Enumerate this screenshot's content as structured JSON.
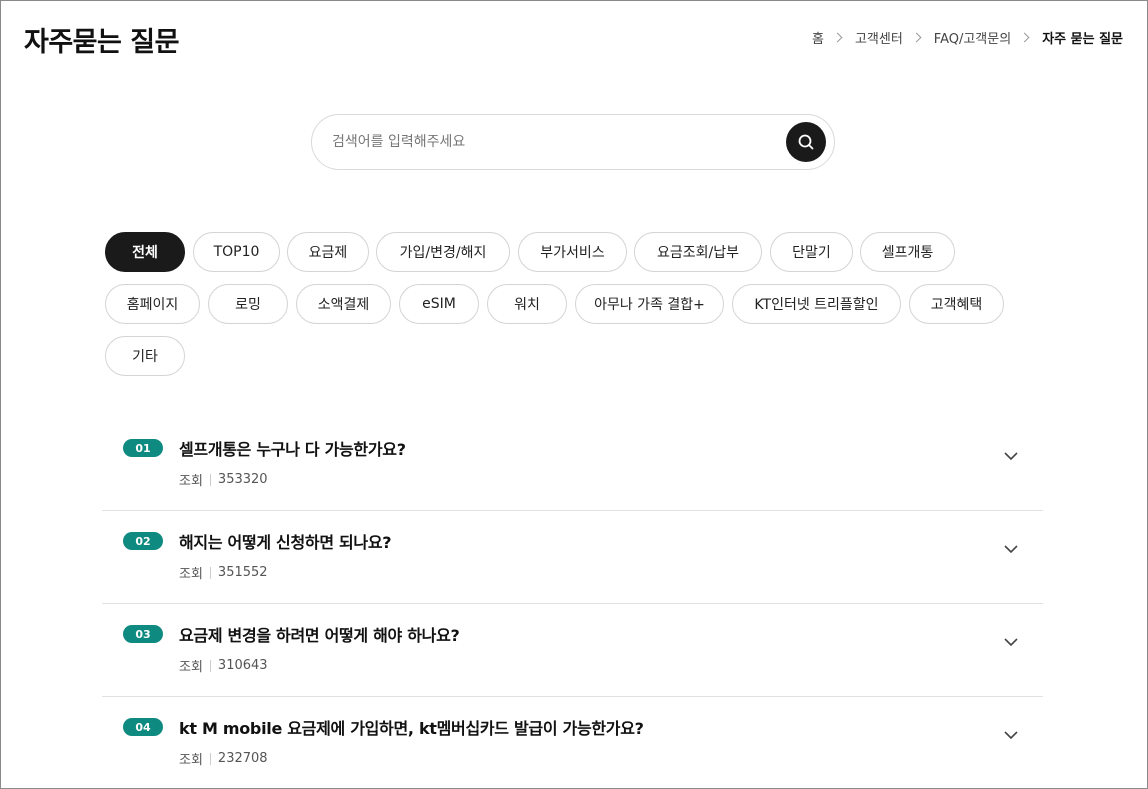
{
  "header": {
    "title": "자주묻는 질문",
    "breadcrumb": [
      "홈",
      "고객센터",
      "FAQ/고객문의",
      "자주 묻는 질문"
    ]
  },
  "search": {
    "placeholder": "검색어를 입력해주세요",
    "value": ""
  },
  "categories": [
    {
      "label": "전체",
      "active": true
    },
    {
      "label": "TOP10"
    },
    {
      "label": "요금제"
    },
    {
      "label": "가입/변경/해지"
    },
    {
      "label": "부가서비스"
    },
    {
      "label": "요금조회/납부"
    },
    {
      "label": "단말기"
    },
    {
      "label": "셀프개통"
    },
    {
      "label": "홈페이지"
    },
    {
      "label": "로밍"
    },
    {
      "label": "소액결제"
    },
    {
      "label": "eSIM"
    },
    {
      "label": "워치"
    },
    {
      "label": "아무나 가족 결합+"
    },
    {
      "label": "KT인터넷 트리플할인"
    },
    {
      "label": "고객혜택"
    },
    {
      "label": "기타"
    }
  ],
  "faq": {
    "views_label": "조회",
    "items": [
      {
        "num": "01",
        "question": "셀프개통은 누구나 다 가능한가요?",
        "views": "353320"
      },
      {
        "num": "02",
        "question": "해지는 어떻게 신청하면 되나요?",
        "views": "351552"
      },
      {
        "num": "03",
        "question": "요금제 변경을 하려면 어떻게 해야 하나요?",
        "views": "310643"
      },
      {
        "num": "04",
        "question": "kt M mobile 요금제에 가입하면, kt멤버십카드 발급이 가능한가요?",
        "views": "232708"
      }
    ]
  },
  "colors": {
    "accent": "#0f8a80",
    "active_chip": "#1a1a1a",
    "search_button": "#1a1a1a"
  },
  "icons": {
    "search": "search-icon",
    "breadcrumb_sep": "chevron-right-icon",
    "expand": "chevron-down-icon"
  }
}
